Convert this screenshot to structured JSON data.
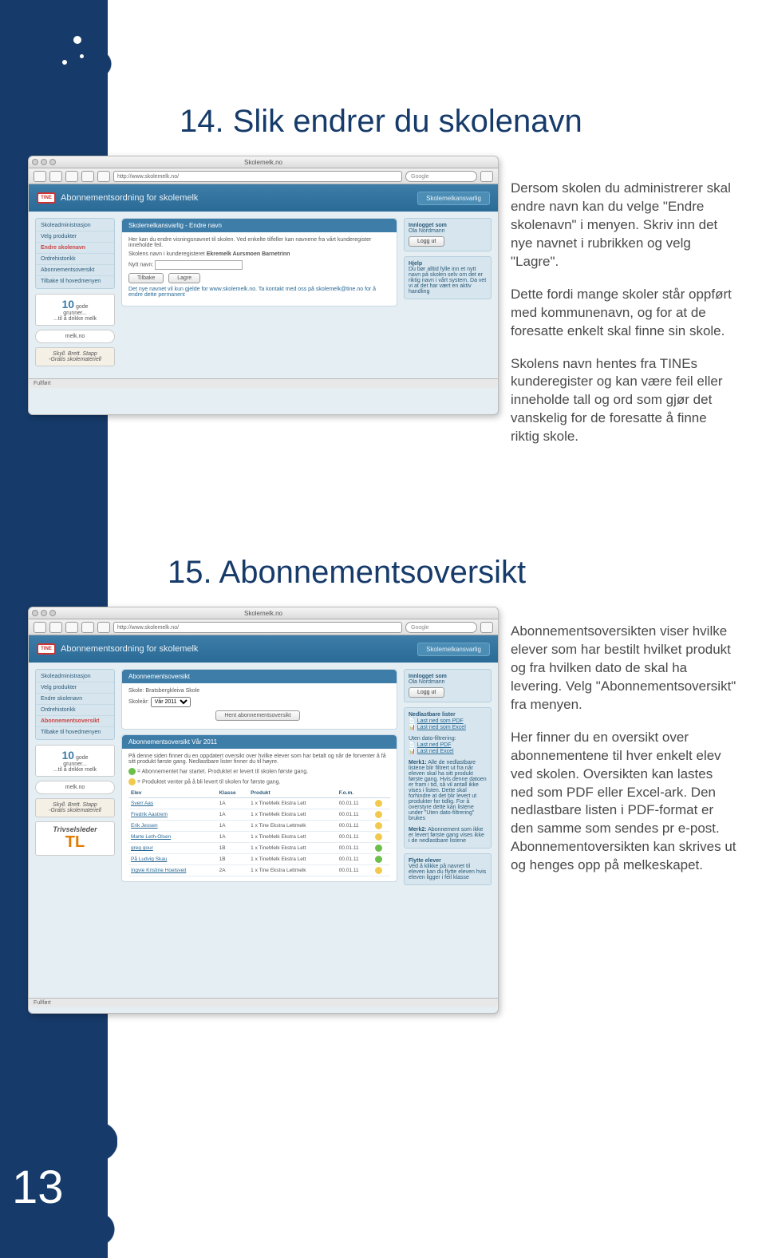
{
  "page_number": "13",
  "section14": {
    "heading": "14. Slik endrer du skolenavn",
    "paragraphs": [
      "Dersom skolen du administrerer skal endre navn kan du velge \"Endre skolenavn\" i menyen. Skriv inn det nye navnet i rubrikken og velg \"Lagre\".",
      "Dette fordi mange skoler står oppført med kommunenavn, og for at de foresatte enkelt skal finne sin skole.",
      "Skolens navn hentes fra TINEs kunderegister og kan være feil eller inneholde tall og ord som gjør det vanskelig for de foresatte å finne riktig skole."
    ]
  },
  "section15": {
    "heading": "15. Abonnementsoversikt",
    "paragraphs": [
      "Abonnementsoversikten viser hvilke elever som har bestilt hvilket produkt og fra hvilken dato de skal ha levering. Velg \"Abonne­mentsoversikt\" fra menyen.",
      "Her finner du en oversikt over abonnementene til hver enkelt elev ved skolen. Oversikten kan lastes ned som PDF eller Excel-ark. Den nedlastbare listen i PDF-format er den samme som sendes pr e-post. Abonnementoversikten kan skrives ut og henges opp på melkeskapet."
    ]
  },
  "browser": {
    "title": "Skolemelk.no",
    "url": "http://www.skolemelk.no/",
    "search_placeholder": "Google",
    "status": "Fullført"
  },
  "app": {
    "header_title": "Abonnementsordning for skolemelk",
    "header_role": "Skolemelkansvarlig",
    "logo_text": "TINE",
    "nav": [
      "Skoleadministrasjon",
      "Velg produkter",
      "Endre skolenavn",
      "Ordrehistorikk",
      "Abonnementsoversikt",
      "Tilbake til hovedmenyen"
    ],
    "logged_in": {
      "title": "Innlogget som",
      "name": "Ola Nordmann",
      "logout": "Logg ut"
    },
    "help": {
      "title": "Hjelp",
      "text": "Du bør alltid fylle inn et nytt navn på skolen selv om det er riktig navn i vårt system. Da vet vi at det har vært en aktiv handling"
    },
    "promo10": {
      "big": "10",
      "line1": "gode",
      "line2": "grunner...",
      "sub": "...til å drikke melk"
    },
    "promo_melkno": "melk.no",
    "promo_skyll": "Skyll. Brett. Stapp",
    "promo_skyll_sub": "-Gratis skolemateriell",
    "promo_trivsel": "Trivselsleder"
  },
  "shot1": {
    "panel_title": "Skolemelkansvarlig - Endre navn",
    "intro": "Her kan du endre visningsnavnet til skolen. Ved enkelte tilfeller kan navnene fra vårt kunderegister inneholde feil.",
    "current_label": "Skolens navn i kunderegisteret",
    "current_value": "Ekremelk Aursmoen Barnetrinn",
    "new_label": "Nytt navn:",
    "btn_back": "Tilbake",
    "btn_save": "Lagre",
    "note": "Det nye navnet vil kun gjelde for www.skolemelk.no. Ta kontakt med oss på skolemelk@tine.no for å endre dette permanent"
  },
  "shot2": {
    "panel1_title": "Abonnementsoversikt",
    "school_label": "Skole:",
    "school_value": "Bratsbergkleiva Skole",
    "year_label": "Skoleår:",
    "year_value": "Vår 2011",
    "btn_fetch": "Hent abonnementsoversikt",
    "panel2_title": "Abonnementsoversikt Vår 2011",
    "intro": "På denne siden finner du en oppdatert oversikt over hvilke elever som har betalt og når de forventer å få sitt produkt første gang. Nedlastbare lister finner du til høyre.",
    "legend_green": "= Abonnementet har startet. Produktet er levert til skolen første gang.",
    "legend_yellow": "= Produktet venter på å bli levert til skolen for første gang.",
    "columns": [
      "Elev",
      "Klasse",
      "Produkt",
      "F.o.m."
    ],
    "rows": [
      {
        "elev": "Sverr Aas",
        "klasse": "1A",
        "produkt": "1 x TineMelk Ekstra Lett",
        "fom": "00.01.11",
        "status": "y"
      },
      {
        "elev": "Fredrik Aastrem",
        "klasse": "1A",
        "produkt": "1 x TineMelk Ekstra Lett",
        "fom": "00.01.11",
        "status": "y"
      },
      {
        "elev": "Erik Jessen",
        "klasse": "1A",
        "produkt": "1 x Tine Ekstra Lettmelk",
        "fom": "00.01.11",
        "status": "y"
      },
      {
        "elev": "Marte Leth-Olsen",
        "klasse": "1A",
        "produkt": "1 x TineMelk Ekstra Lett",
        "fom": "00.01.11",
        "status": "y"
      },
      {
        "elev": "greg gour",
        "klasse": "1B",
        "produkt": "1 x TineMelk Ekstra Lett",
        "fom": "00.01.11",
        "status": "g"
      },
      {
        "elev": "På Ludvig Skau",
        "klasse": "1B",
        "produkt": "1 x TineMelk Ekstra Lett",
        "fom": "00.01.11",
        "status": "g"
      },
      {
        "elev": "Ingvie Kristine Hoelsveit",
        "klasse": "2A",
        "produkt": "1 x Tine Ekstra Lettmelk",
        "fom": "00.01.11",
        "status": "y"
      }
    ],
    "downloads": {
      "title": "Nedlastbare lister",
      "pdf": "Last ned som PDF",
      "excel": "Last ned som Excel",
      "filter_title": "Uten dato-filtrering:",
      "pdf2": "Last ned PDF",
      "excel2": "Last ned Excel",
      "note1_label": "Merk1:",
      "note1": "Alle de nedlastbare listene blir filtrert ut fra når eleven skal ha sitt produkt første gang. Hvis denne datoen er fram i tid, så vil antall ikke vises i listen. Dette skal forhindre at det blir levert ut produkter for tidlig. For å overstyre dette kan listene under \"Uten dato-filtrering\" brukes",
      "note2_label": "Merk2:",
      "note2": "Abonnement som ikke er levert første gang vises ikke i de nedlastbare listene"
    },
    "move": {
      "title": "Flytte elever",
      "text": "Ved å klikke på navnet til eleven kan du flytte eleven hvis eleven ligger i feil klasse"
    }
  }
}
